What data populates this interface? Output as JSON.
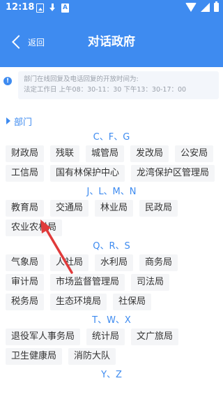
{
  "status_bar": {
    "time": "12:18",
    "left_icons": [
      "image-icon",
      "download-icon",
      "a-icon"
    ],
    "right_icons": [
      "wifi-icon",
      "signal-icon",
      "battery-icon"
    ]
  },
  "header": {
    "back_label": "返回",
    "title": "对话政府"
  },
  "notice": {
    "icon": "info-icon",
    "line1": "部门在线回复及电话回复的开放时间为:",
    "line2": "法定工作日 上午08：30-11：30 下午13：30-17：00"
  },
  "section": {
    "label": "部门"
  },
  "groups": [
    {
      "title": "C、F、G",
      "rows": [
        [
          "财政局",
          "残联",
          "城管局",
          "发改局",
          "公安局"
        ],
        [
          "工信局",
          "国有林保护中心",
          "龙湾保护区管理局"
        ]
      ]
    },
    {
      "title": "J、L、M、N",
      "rows": [
        [
          "教育局",
          "交通局",
          "林业局",
          "民政局"
        ],
        [
          "农业农村局"
        ]
      ]
    },
    {
      "title": "Q、R、S",
      "rows": [
        [
          "气象局",
          "人社局",
          "水利局",
          "商务局"
        ],
        [
          "审计局",
          "市场监督管理局",
          "司法局"
        ],
        [
          "税务局",
          "生态环境局",
          "社保局"
        ]
      ]
    },
    {
      "title": "T、W、X",
      "rows": [
        [
          "退役军人事务局",
          "统计局",
          "文广旅局"
        ],
        [
          "卫生健康局",
          "消防大队"
        ]
      ]
    },
    {
      "title": "Y、Z",
      "rows": []
    }
  ],
  "colors": {
    "accent": "#3e8bf0",
    "annotation_arrow": "#e03a3a"
  }
}
